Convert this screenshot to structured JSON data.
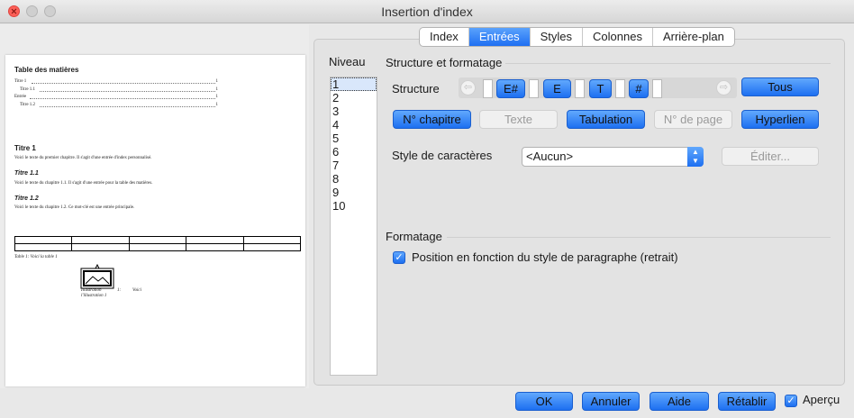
{
  "window": {
    "title": "Insertion d'index"
  },
  "tabs": [
    {
      "label": "Index",
      "active": false
    },
    {
      "label": "Entrées",
      "active": true
    },
    {
      "label": "Styles",
      "active": false
    },
    {
      "label": "Colonnes",
      "active": false
    },
    {
      "label": "Arrière-plan",
      "active": false
    }
  ],
  "niveau": {
    "label": "Niveau",
    "items": [
      "1",
      "2",
      "3",
      "4",
      "5",
      "6",
      "7",
      "8",
      "9",
      "10"
    ],
    "selected": "1"
  },
  "structure_formatage": {
    "title": "Structure et formatage",
    "structure_label": "Structure",
    "tokens": [
      "E#",
      "E",
      "T",
      "#"
    ],
    "tous_label": "Tous",
    "buttons": {
      "chapitre": "N° chapitre",
      "texte": "Texte",
      "tabulation": "Tabulation",
      "numero_page": "N° de page",
      "hyperlien": "Hyperlien"
    },
    "style_caracteres_label": "Style de caractères",
    "style_caracteres_value": "<Aucun>",
    "editer_label": "Éditer..."
  },
  "formatage": {
    "title": "Formatage",
    "checkbox_label": "Position en fonction du style de paragraphe (retrait)",
    "checked": true
  },
  "footer": {
    "ok": "OK",
    "annuler": "Annuler",
    "aide": "Aide",
    "retablir": "Rétablir",
    "apercu": "Aperçu",
    "apercu_checked": true
  },
  "preview": {
    "toc_title": "Table des matières",
    "toc_entries": [
      {
        "text": "Titre 1",
        "page": "1"
      },
      {
        "text": "Titre 1.1",
        "page": "1"
      },
      {
        "text": "Entrée",
        "page": "1"
      },
      {
        "text": "Titre 1.2",
        "page": "1"
      }
    ],
    "h1": "Titre 1",
    "h1_body": "Voici le texte du premier chapitre. Il s'agit d'une entrée d'index personnalisé.",
    "h11": "Titre 1.1",
    "h11_body": "Voici le texte du chapitre 1.1. Il s'agit d'une entrée pour la table des matières.",
    "h12": "Titre 1.2",
    "h12_body": "Voici le texte du chapitre 1.2. Ce mot-clé est une entrée principale.",
    "table_caption": "Table 1: Voici la table 1",
    "illustration_caption_1": "Illustration",
    "illustration_caption_2": "1:",
    "illustration_caption_3": "Voici",
    "illustration_caption_4": "l'illustration 1"
  }
}
